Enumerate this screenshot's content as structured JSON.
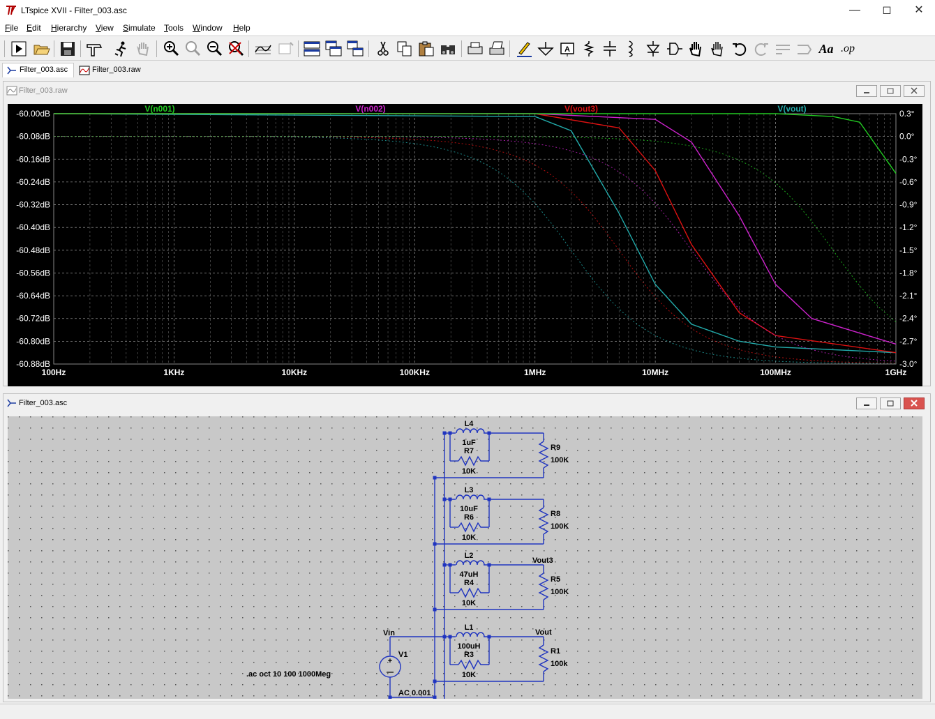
{
  "window": {
    "title": "LTspice XVII - Filter_003.asc"
  },
  "menu": [
    {
      "key": "F",
      "rest": "ile"
    },
    {
      "key": "E",
      "rest": "dit"
    },
    {
      "key": "H",
      "rest": "ierarchy"
    },
    {
      "key": "V",
      "rest": "iew"
    },
    {
      "key": "S",
      "rest": "imulate"
    },
    {
      "key": "T",
      "rest": "ools"
    },
    {
      "key": "W",
      "rest": "indow"
    },
    {
      "key": "H",
      "rest": "elp"
    }
  ],
  "tabs": [
    {
      "label": "Filter_003.asc",
      "active": true,
      "icon": "schematic-icon"
    },
    {
      "label": "Filter_003.raw",
      "active": false,
      "icon": "waveform-icon"
    }
  ],
  "toolbar": {
    "buttons": [
      "run-icon",
      "open-icon",
      "save-icon",
      "control-panel-icon",
      "pick-visible-traces-icon",
      "pan-icon",
      "zoom-in-icon",
      "zoom-area-icon",
      "zoom-out-icon",
      "zoom-fit-icon",
      "autorange-icon",
      "delete-plot-icon",
      "tile-horizontal-icon",
      "cascade-icon",
      "tile-vertical-icon",
      "cut-icon",
      "copy-icon",
      "paste-icon",
      "find-icon",
      "print-setup-icon",
      "print-icon",
      "draw-wire-icon",
      "ground-icon",
      "label-net-icon",
      "resistor-icon",
      "capacitor-icon",
      "inductor-icon",
      "diode-icon",
      "component-icon",
      "move-icon",
      "drag-icon",
      "undo-icon",
      "redo-icon",
      "rotate-icon",
      "mirror-icon",
      "text-icon",
      "spice-directive-icon"
    ],
    "op_label": ".op",
    "text_label": "Aa"
  },
  "plot_window": {
    "title": "Filter_003.raw",
    "y_left_ticks": [
      "-60.00dB",
      "-60.08dB",
      "-60.16dB",
      "-60.24dB",
      "-60.32dB",
      "-60.40dB",
      "-60.48dB",
      "-60.56dB",
      "-60.64dB",
      "-60.72dB",
      "-60.80dB",
      "-60.88dB"
    ],
    "y_right_ticks": [
      "0.3°",
      "0.0°",
      "-0.3°",
      "-0.6°",
      "-0.9°",
      "-1.2°",
      "-1.5°",
      "-1.8°",
      "-2.1°",
      "-2.4°",
      "-2.7°",
      "-3.0°"
    ],
    "x_ticks": [
      "100Hz",
      "1KHz",
      "10KHz",
      "100KHz",
      "1MHz",
      "10MHz",
      "100MHz",
      "1GHz"
    ],
    "traces": [
      {
        "name": "V(n001)",
        "color": "#22cc22"
      },
      {
        "name": "V(n002)",
        "color": "#cc22cc"
      },
      {
        "name": "V(vout3)",
        "color": "#dd1111"
      },
      {
        "name": "V(vout)",
        "color": "#22aaaa"
      }
    ]
  },
  "chart_data": {
    "type": "line",
    "x_scale": "log",
    "xlim": [
      100,
      1000000000
    ],
    "ylim_db": [
      -60.88,
      -60.0
    ],
    "ylim_phase_deg": [
      -3.0,
      0.3
    ],
    "series": [
      {
        "name": "V(vout)",
        "color": "#22aaaa",
        "f_corner_hz": 2000000,
        "x": [
          100,
          1000000,
          2000000,
          5000000,
          10000000,
          20000000,
          50000000,
          100000000,
          1000000000
        ],
        "magnitude_db": [
          -60.0,
          -60.01,
          -60.06,
          -60.35,
          -60.6,
          -60.74,
          -60.8,
          -60.82,
          -60.84
        ]
      },
      {
        "name": "V(vout3)",
        "color": "#dd1111",
        "f_corner_hz": 5000000,
        "x": [
          100,
          1000000,
          5000000,
          10000000,
          20000000,
          50000000,
          100000000,
          1000000000
        ],
        "magnitude_db": [
          -60.0,
          -60.0,
          -60.05,
          -60.2,
          -60.46,
          -60.7,
          -60.78,
          -60.84
        ]
      },
      {
        "name": "V(n002)",
        "color": "#cc22cc",
        "f_corner_hz": 20000000,
        "x": [
          100,
          1000000,
          10000000,
          20000000,
          50000000,
          100000000,
          200000000,
          1000000000
        ],
        "magnitude_db": [
          -60.0,
          -60.0,
          -60.02,
          -60.1,
          -60.36,
          -60.6,
          -60.72,
          -60.81
        ]
      },
      {
        "name": "V(n001)",
        "color": "#22cc22",
        "f_corner_hz": 300000000,
        "x": [
          100,
          10000000,
          100000000,
          300000000,
          500000000,
          1000000000
        ],
        "magnitude_db": [
          -60.0,
          -60.0,
          -60.0,
          -60.01,
          -60.03,
          -60.21
        ]
      }
    ]
  },
  "schematic_window": {
    "title": "Filter_003.asc",
    "directive": ".ac oct 10 100 1000Meg",
    "source": {
      "name": "V1",
      "value": "AC 0.001"
    },
    "net_labels": {
      "vin": "Vin",
      "vout": "Vout",
      "vout3": "Vout3"
    },
    "stages": [
      {
        "inductor": "L4",
        "l_value": "1uF",
        "resistor": "R7",
        "r_value": "10K",
        "load": "R9",
        "load_value": "100K"
      },
      {
        "inductor": "L3",
        "l_value": "10uF",
        "resistor": "R6",
        "r_value": "10K",
        "load": "R8",
        "load_value": "100K"
      },
      {
        "inductor": "L2",
        "l_value": "47uH",
        "resistor": "R4",
        "r_value": "10K",
        "load": "R5",
        "load_value": "100K"
      },
      {
        "inductor": "L1",
        "l_value": "100uH",
        "resistor": "R3",
        "r_value": "10K",
        "load": "R1",
        "load_value": "100k"
      }
    ]
  }
}
